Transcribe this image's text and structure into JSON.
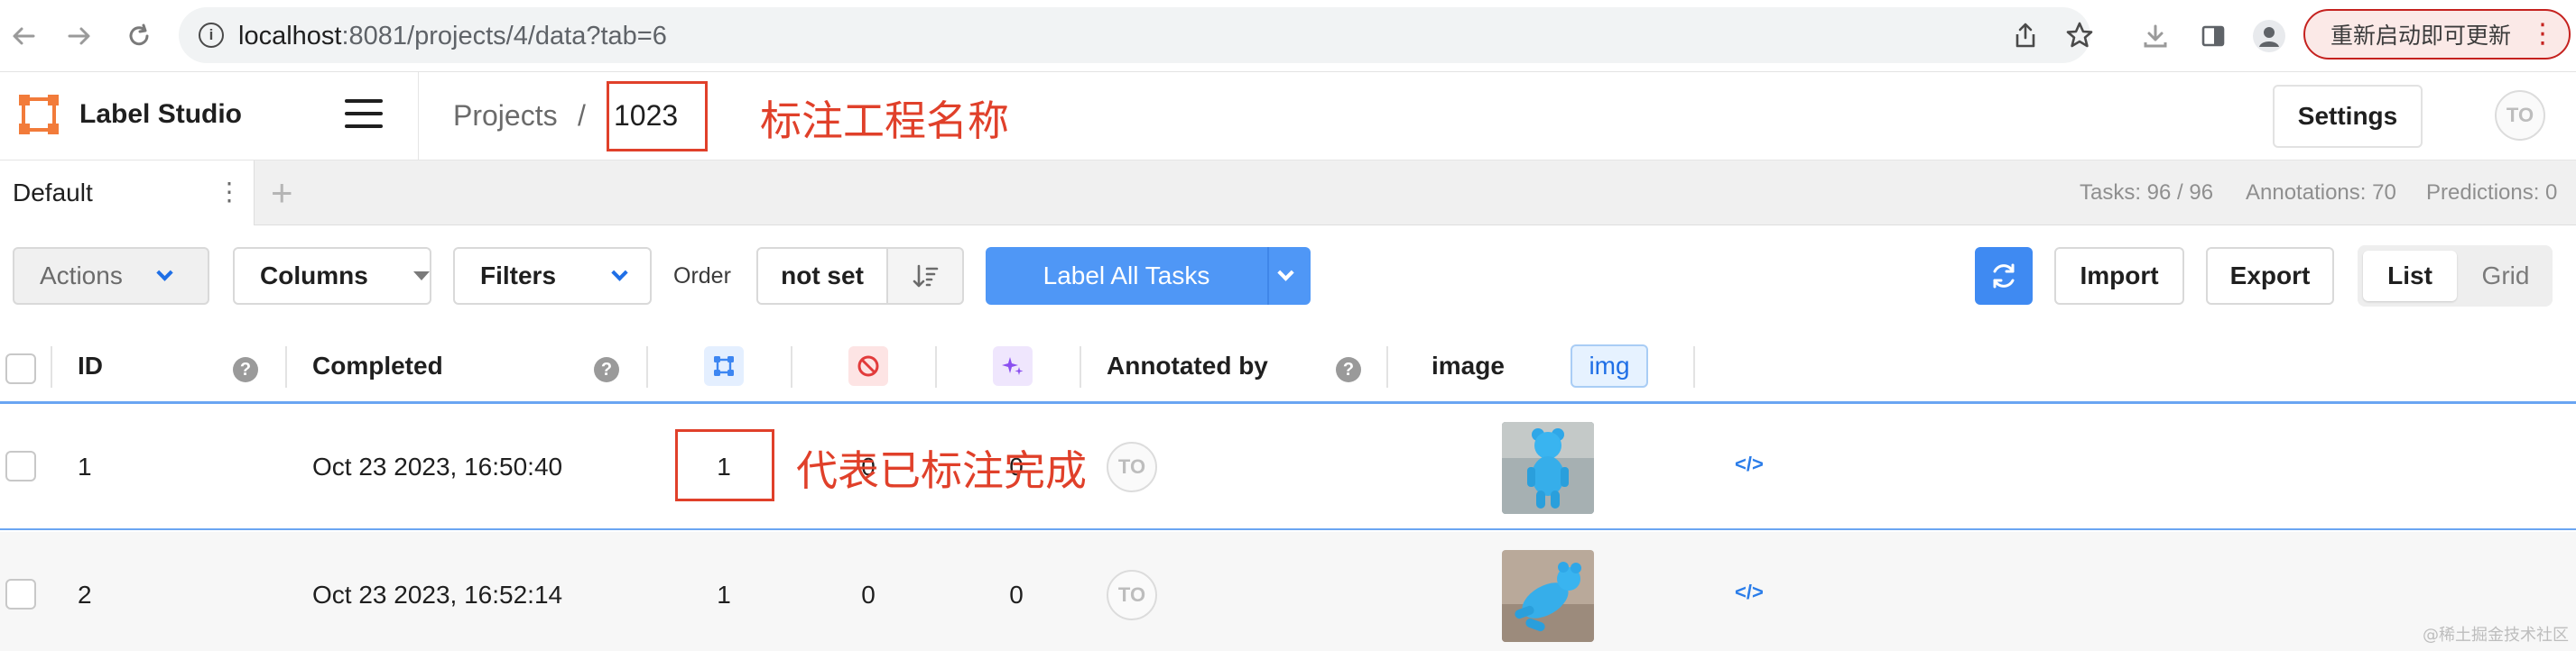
{
  "browser": {
    "url_host": "localhost",
    "url_path": ":8081/projects/4/data?tab=6",
    "update_button": "重新启动即可更新"
  },
  "header": {
    "app_name": "Label Studio",
    "breadcrumb_projects": "Projects",
    "breadcrumb_sep": "/",
    "project_name": "1023",
    "settings_label": "Settings",
    "user_initials": "TO"
  },
  "annotations": {
    "project_name_note": "标注工程名称",
    "completed_note": "代表已标注完成"
  },
  "tabs": {
    "items": [
      {
        "label": "Default"
      }
    ],
    "add_label": "+",
    "stats": {
      "tasks": "Tasks: 96 / 96",
      "annotations": "Annotations: 70",
      "predictions": "Predictions: 0"
    }
  },
  "toolbar": {
    "actions": "Actions",
    "columns": "Columns",
    "filters": "Filters",
    "order_label": "Order",
    "order_value": "not set",
    "label_all": "Label All Tasks",
    "import": "Import",
    "export": "Export",
    "view_list": "List",
    "view_grid": "Grid",
    "active_view": "List"
  },
  "table": {
    "columns": {
      "id": "ID",
      "completed": "Completed",
      "annotated_by": "Annotated by",
      "image": "image",
      "image_badge": "img"
    },
    "rows": [
      {
        "id": "1",
        "completed": "Oct 23 2023, 16:50:40",
        "annotations": "1",
        "cancelled": "0",
        "predictions": "0",
        "annotator": "TO",
        "image_desc": "blue-bear-standing",
        "code": "</>"
      },
      {
        "id": "2",
        "completed": "Oct 23 2023, 16:52:14",
        "annotations": "1",
        "cancelled": "0",
        "predictions": "0",
        "annotator": "TO",
        "image_desc": "blue-bear-lying",
        "code": "</>"
      }
    ]
  },
  "watermark": "@稀土掘金技术社区",
  "colors": {
    "accent": "#4f97f6",
    "annotation_red": "#e0402a",
    "row_selected_border": "#6aa5f2"
  }
}
